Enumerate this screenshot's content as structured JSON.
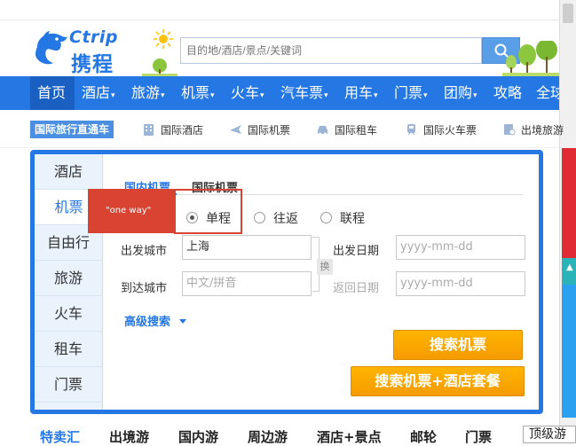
{
  "header": {
    "logo_en": "Ctrip",
    "logo_cn": "携程",
    "search_placeholder": "目的地/酒店/景点/关键词"
  },
  "nav": {
    "items": [
      {
        "label": "首页",
        "caret": ""
      },
      {
        "label": "酒店",
        "caret": "▾"
      },
      {
        "label": "旅游",
        "caret": "▾"
      },
      {
        "label": "机票",
        "caret": "▾"
      },
      {
        "label": "火车",
        "caret": "▾"
      },
      {
        "label": "汽车票",
        "caret": "▾"
      },
      {
        "label": "用车",
        "caret": "▾"
      },
      {
        "label": "门票",
        "caret": "▾"
      },
      {
        "label": "团购",
        "caret": "▾"
      },
      {
        "label": "攻略",
        "caret": ""
      },
      {
        "label": "全球购",
        "caret": ""
      }
    ]
  },
  "subnav": {
    "tag": "国际旅行直通车",
    "items": [
      {
        "label": "国际酒店",
        "icon": "building-icon"
      },
      {
        "label": "国际机票",
        "icon": "plane-icon"
      },
      {
        "label": "国际租车",
        "icon": "car-icon"
      },
      {
        "label": "国际火车票",
        "icon": "train-icon"
      },
      {
        "label": "出境旅游",
        "icon": "passport-icon"
      }
    ]
  },
  "booking": {
    "side_tabs": [
      "酒店",
      "机票",
      "自由行",
      "旅游",
      "火车",
      "租车",
      "门票"
    ],
    "active_side_tab": "机票",
    "tabs": {
      "domestic": "国内机票",
      "international": "国际机票"
    },
    "trip_types": [
      {
        "label": "单程",
        "checked": true
      },
      {
        "label": "往返",
        "checked": false
      },
      {
        "label": "联程",
        "checked": false
      }
    ],
    "depart_city_label": "出发城市",
    "depart_city_value": "上海",
    "arrive_city_label": "到达城市",
    "arrive_city_placeholder": "中文/拼音",
    "depart_date_label": "出发日期",
    "depart_date_placeholder": "yyyy-mm-dd",
    "return_date_label": "返回日期",
    "return_date_placeholder": "yyyy-mm-dd",
    "swap_label": "换",
    "advanced_search": "高级搜索",
    "search_flights": "搜索机票",
    "search_flight_hotel": "搜索机票+酒店套餐"
  },
  "annotation": {
    "label": "\"one way\"",
    "color": "#d84332"
  },
  "bottom": {
    "items": [
      "特卖汇",
      "出境游",
      "国内游",
      "周边游",
      "酒店+景点",
      "邮轮",
      "门票"
    ],
    "top_tour": "顶级游"
  },
  "colors": {
    "brand_blue": "#2577e3",
    "orange": "#f59b00",
    "annotation_red": "#d84332"
  }
}
